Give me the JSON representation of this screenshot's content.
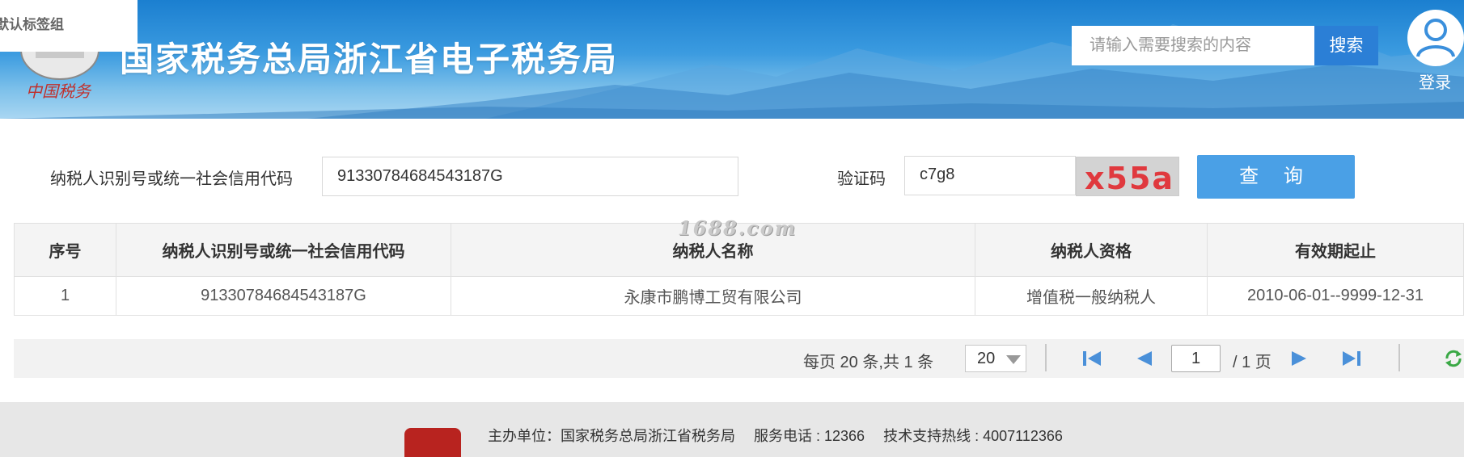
{
  "browser": {
    "tab_group_label": "默认标签组"
  },
  "header": {
    "site_title": "国家税务总局浙江省电子税务局",
    "search_placeholder": "请输入需要搜索的内容",
    "search_button": "搜索",
    "login_label": "登录"
  },
  "query": {
    "taxpayer_id_label": "纳税人识别号或统一社会信用代码",
    "taxpayer_id_value": "91330784684543187G",
    "captcha_label": "验证码",
    "captcha_value": "c7g8",
    "captcha_image_text": "x55a",
    "query_button": "查 询"
  },
  "watermark": "1688.com",
  "table": {
    "columns": [
      "序号",
      "纳税人识别号或统一社会信用代码",
      "纳税人名称",
      "纳税人资格",
      "有效期起止"
    ],
    "rows": [
      [
        "1",
        "91330784684543187G",
        "永康市鹏博工贸有限公司",
        "增值税一般纳税人",
        "2010-06-01--9999-12-31"
      ]
    ]
  },
  "pager": {
    "summary": "每页 20 条,共 1 条",
    "page_size": "20",
    "current_page": "1",
    "total_pages": "/ 1 页"
  },
  "footer": {
    "sponsor": "主办单位：国家税务总局浙江省税务局",
    "service_phone": "服务电话 : 12366",
    "support_hotline": "技术支持热线 : 4007112366"
  },
  "colors": {
    "header_blue": "#1b7fd0",
    "search_button": "#2b7fd6",
    "query_button": "#4aa0e6",
    "pager_icon": "#4a90d9",
    "refresh_icon": "#3aa845"
  }
}
